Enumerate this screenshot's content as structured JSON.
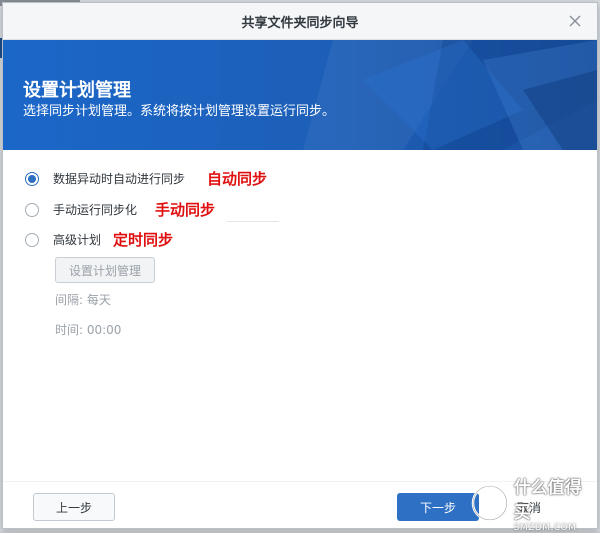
{
  "dialog": {
    "title": "共享文件夹同步向导",
    "close_icon": "close-icon"
  },
  "banner": {
    "title": "设置计划管理",
    "subtitle": "选择同步计划管理。系统将按计划管理设置运行同步。"
  },
  "options": [
    {
      "label": "数据异动时自动进行同步",
      "checked": true,
      "annotation": "自动同步"
    },
    {
      "label": "手动运行同步化",
      "checked": false,
      "annotation": "手动同步"
    },
    {
      "label": "高级计划",
      "checked": false,
      "annotation": "定时同步"
    }
  ],
  "schedule": {
    "button_label": "设置计划管理",
    "interval": "间隔: 每天",
    "time": "时间: 00:00"
  },
  "footer": {
    "prev_label": "上一步",
    "next_label": "下一步",
    "cancel_label": "取消"
  },
  "watermark": {
    "line1": "什么值得买",
    "line2": "SMZDM.COM"
  },
  "colors": {
    "accent": "#2d70c4",
    "banner": "#1d5fb8",
    "annotation": "#e01010"
  }
}
